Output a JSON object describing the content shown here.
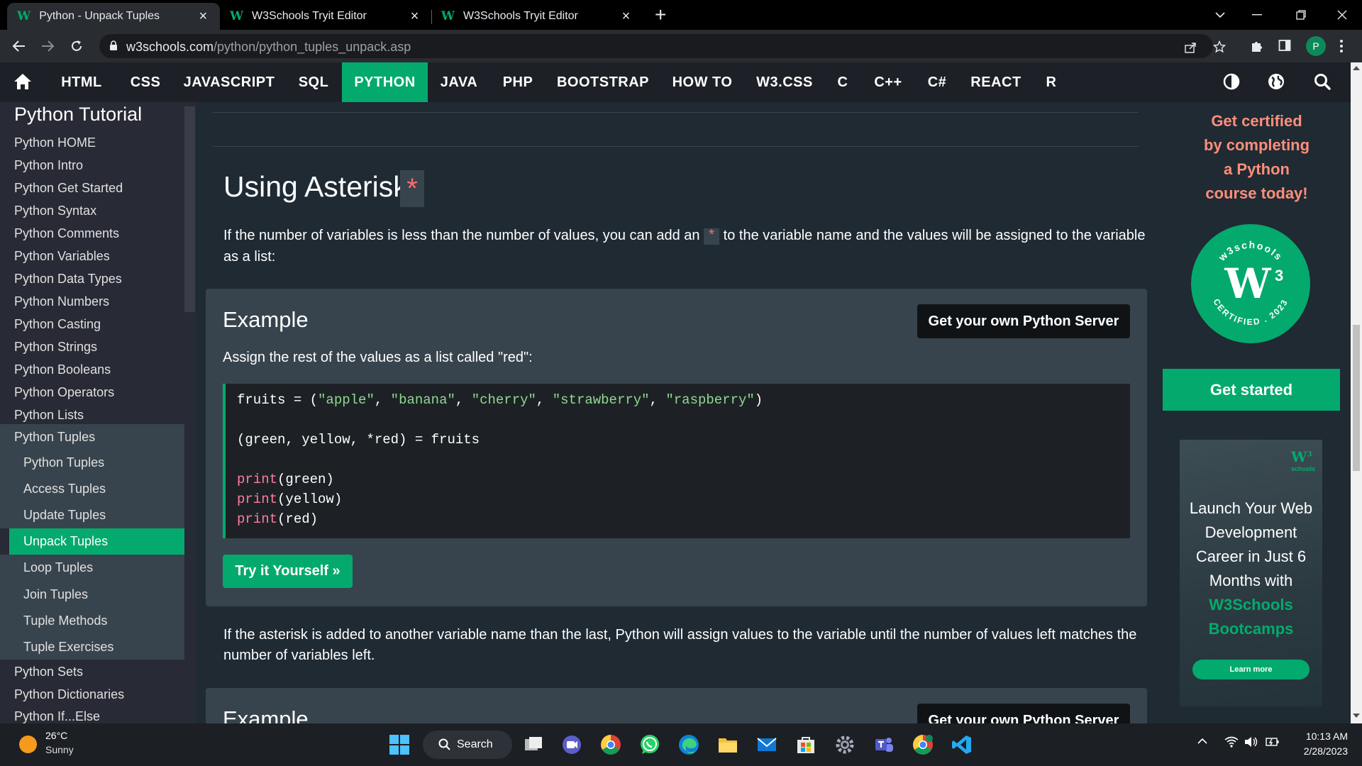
{
  "browser": {
    "tabs": [
      {
        "title": "Python - Unpack Tuples",
        "active": true,
        "favicon": "w3schools-logo"
      },
      {
        "title": "W3Schools Tryit Editor",
        "active": false,
        "favicon": "w3schools-logo"
      },
      {
        "title": "W3Schools Tryit Editor",
        "active": false,
        "favicon": "w3schools-logo"
      }
    ],
    "favicon_glyph": "W",
    "tab_close": "×",
    "new_tab": "+",
    "url_domain": "w3schools.com",
    "url_path": "/python/python_tuples_unpack.asp",
    "profile_initial": "P"
  },
  "topnav": {
    "items": [
      "HTML",
      "CSS",
      "JAVASCRIPT",
      "SQL",
      "PYTHON",
      "JAVA",
      "PHP",
      "BOOTSTRAP",
      "HOW TO",
      "W3.CSS",
      "C",
      "C++",
      "C#",
      "REACT",
      "R"
    ],
    "active": "PYTHON"
  },
  "sidebar": {
    "heading": "Python Tutorial",
    "items": [
      "Python HOME",
      "Python Intro",
      "Python Get Started",
      "Python Syntax",
      "Python Comments",
      "Python Variables",
      "Python Data Types",
      "Python Numbers",
      "Python Casting",
      "Python Strings",
      "Python Booleans",
      "Python Operators",
      "Python Lists",
      "Python Tuples"
    ],
    "subitems": [
      "Python Tuples",
      "Access Tuples",
      "Update Tuples",
      "Unpack Tuples",
      "Loop Tuples",
      "Join Tuples",
      "Tuple Methods",
      "Tuple Exercises"
    ],
    "selected_subitem": "Unpack Tuples",
    "items_after": [
      "Python Sets",
      "Python Dictionaries",
      "Python If...Else"
    ]
  },
  "main": {
    "heading": "Using Asterisk",
    "heading_star": "*",
    "intro_before": "If the number of variables is less than the number of values, you can add an",
    "intro_code": "*",
    "intro_after": "to the variable name and the values will be assigned to the variable as a list:",
    "example1": {
      "title": "Example",
      "server_button": "Get your own Python Server",
      "description": "Assign the rest of the values as a list called \"red\":",
      "code_lines": [
        "fruits = (\"apple\", \"banana\", \"cherry\", \"strawberry\", \"raspberry\")",
        "",
        "(green, yellow, *red) = fruits",
        "",
        "print(green)",
        "print(yellow)",
        "print(red)"
      ],
      "try_button": "Try it Yourself »"
    },
    "para2": "If the asterisk is added to another variable name than the last, Python will assign values to the variable until the number of values left matches the number of variables left.",
    "example2": {
      "title": "Example",
      "server_button": "Get your own Python Server"
    }
  },
  "rightcol": {
    "cert_text_lines": [
      "Get certified",
      "by completing",
      "a Python",
      "course today!"
    ],
    "badge_top": "w3schools",
    "badge_bottom": "CERTIFIED . 2023",
    "badge_mark": "W",
    "badge_sup": "3",
    "get_started": "Get started",
    "bootcamp_logo": "W",
    "bootcamp_logo_sup": "3",
    "bootcamp_logo_sub": "schools",
    "bootcamp_text": "Launch Your Web Development Career in Just 6 Months with",
    "bootcamp_accent": "W3Schools Bootcamps",
    "bootcamp_button": "Learn more"
  },
  "taskbar": {
    "weather_temp": "26°C",
    "weather_cond": "Sunny",
    "search_label": "Search",
    "time": "10:13 AM",
    "date": "2/28/2023",
    "apps": [
      "start-menu",
      "search",
      "task-view",
      "meet",
      "chrome",
      "whatsapp",
      "edge",
      "file-explorer",
      "mail",
      "store",
      "settings",
      "teams",
      "chrome-profile",
      "vscode"
    ]
  },
  "colors": {
    "accent_green": "#04aa6d",
    "code_string": "#8fd98f",
    "code_keyword": "#ff7b9c",
    "cert_text": "#ff8e7a"
  }
}
